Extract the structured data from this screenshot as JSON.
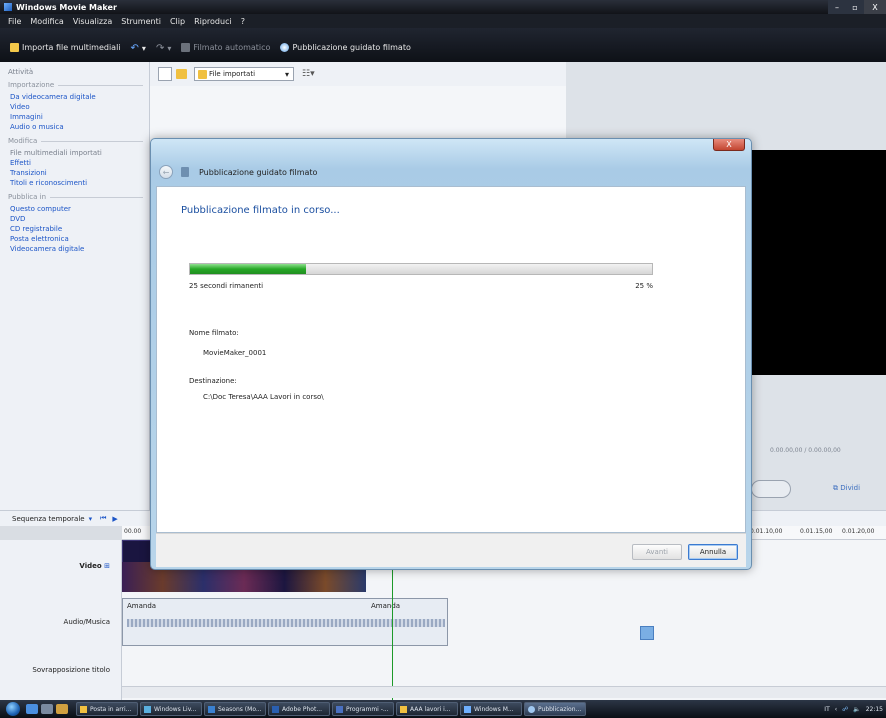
{
  "window": {
    "title": "Windows Movie Maker",
    "controls": [
      "–",
      "▫",
      "X"
    ]
  },
  "menu": [
    "File",
    "Modifica",
    "Visualizza",
    "Strumenti",
    "Clip",
    "Riproduci",
    "?"
  ],
  "toolbar": {
    "import_label": "Importa file multimediali",
    "automovie_label": "Filmato automatico",
    "publish_label": "Pubblicazione guidato filmato"
  },
  "tasks": {
    "header": "Attività",
    "sections": [
      {
        "title": "Importazione",
        "items": [
          "Da videocamera digitale",
          "Video",
          "Immagini",
          "Audio o musica"
        ]
      },
      {
        "title": "Modifica",
        "items": [
          "File multimediali importati",
          "Effetti",
          "Transizioni",
          "Titoli e riconoscimenti"
        ]
      },
      {
        "title": "Pubblica in",
        "items": [
          "Questo computer",
          "DVD",
          "CD registrabile",
          "Posta elettronica",
          "Videocamera digitale"
        ]
      }
    ]
  },
  "collection": {
    "selected": "File importati"
  },
  "preview": {
    "timecode": "0.00.00,00 / 0.00.00,00",
    "split_label": "Dividi"
  },
  "timeline": {
    "view_label": "Sequenza temporale",
    "ticks": [
      "00.00",
      "0.01.10,00",
      "0.01.15,00",
      "0.01.20,00"
    ],
    "tracks": {
      "video": "Video",
      "audio": "Audio/Musica",
      "title_overlay": "Sovrapposizione titolo"
    },
    "audio_clips": [
      "Amanda",
      "Amanda"
    ]
  },
  "dialog": {
    "header": "Pubblicazione guidato filmato",
    "close": "X",
    "heading": "Pubblicazione filmato in corso...",
    "progress_fraction": 0.25,
    "remaining": "25 secondi rimanenti",
    "percent": "25 %",
    "name_label": "Nome filmato:",
    "name_value": "MovieMaker_0001",
    "dest_label": "Destinazione:",
    "dest_value": "C:\\Doc Teresa\\AAA Lavori in corso\\",
    "next_label": "Avanti",
    "cancel_label": "Annulla"
  },
  "taskbar": {
    "items": [
      "Posta in arri...",
      "Windows Liv...",
      "Seasons (Mo...",
      "Adobe Phot...",
      "Programmi -...",
      "AAA lavori i...",
      "Windows M...",
      "Pubblicazion..."
    ],
    "tray": [
      "IT",
      "22:15"
    ]
  },
  "colors": {
    "link": "#1c55c7",
    "heading": "#1b4fa0",
    "progress": "#27a827",
    "playhead": "#1e9a2a"
  }
}
